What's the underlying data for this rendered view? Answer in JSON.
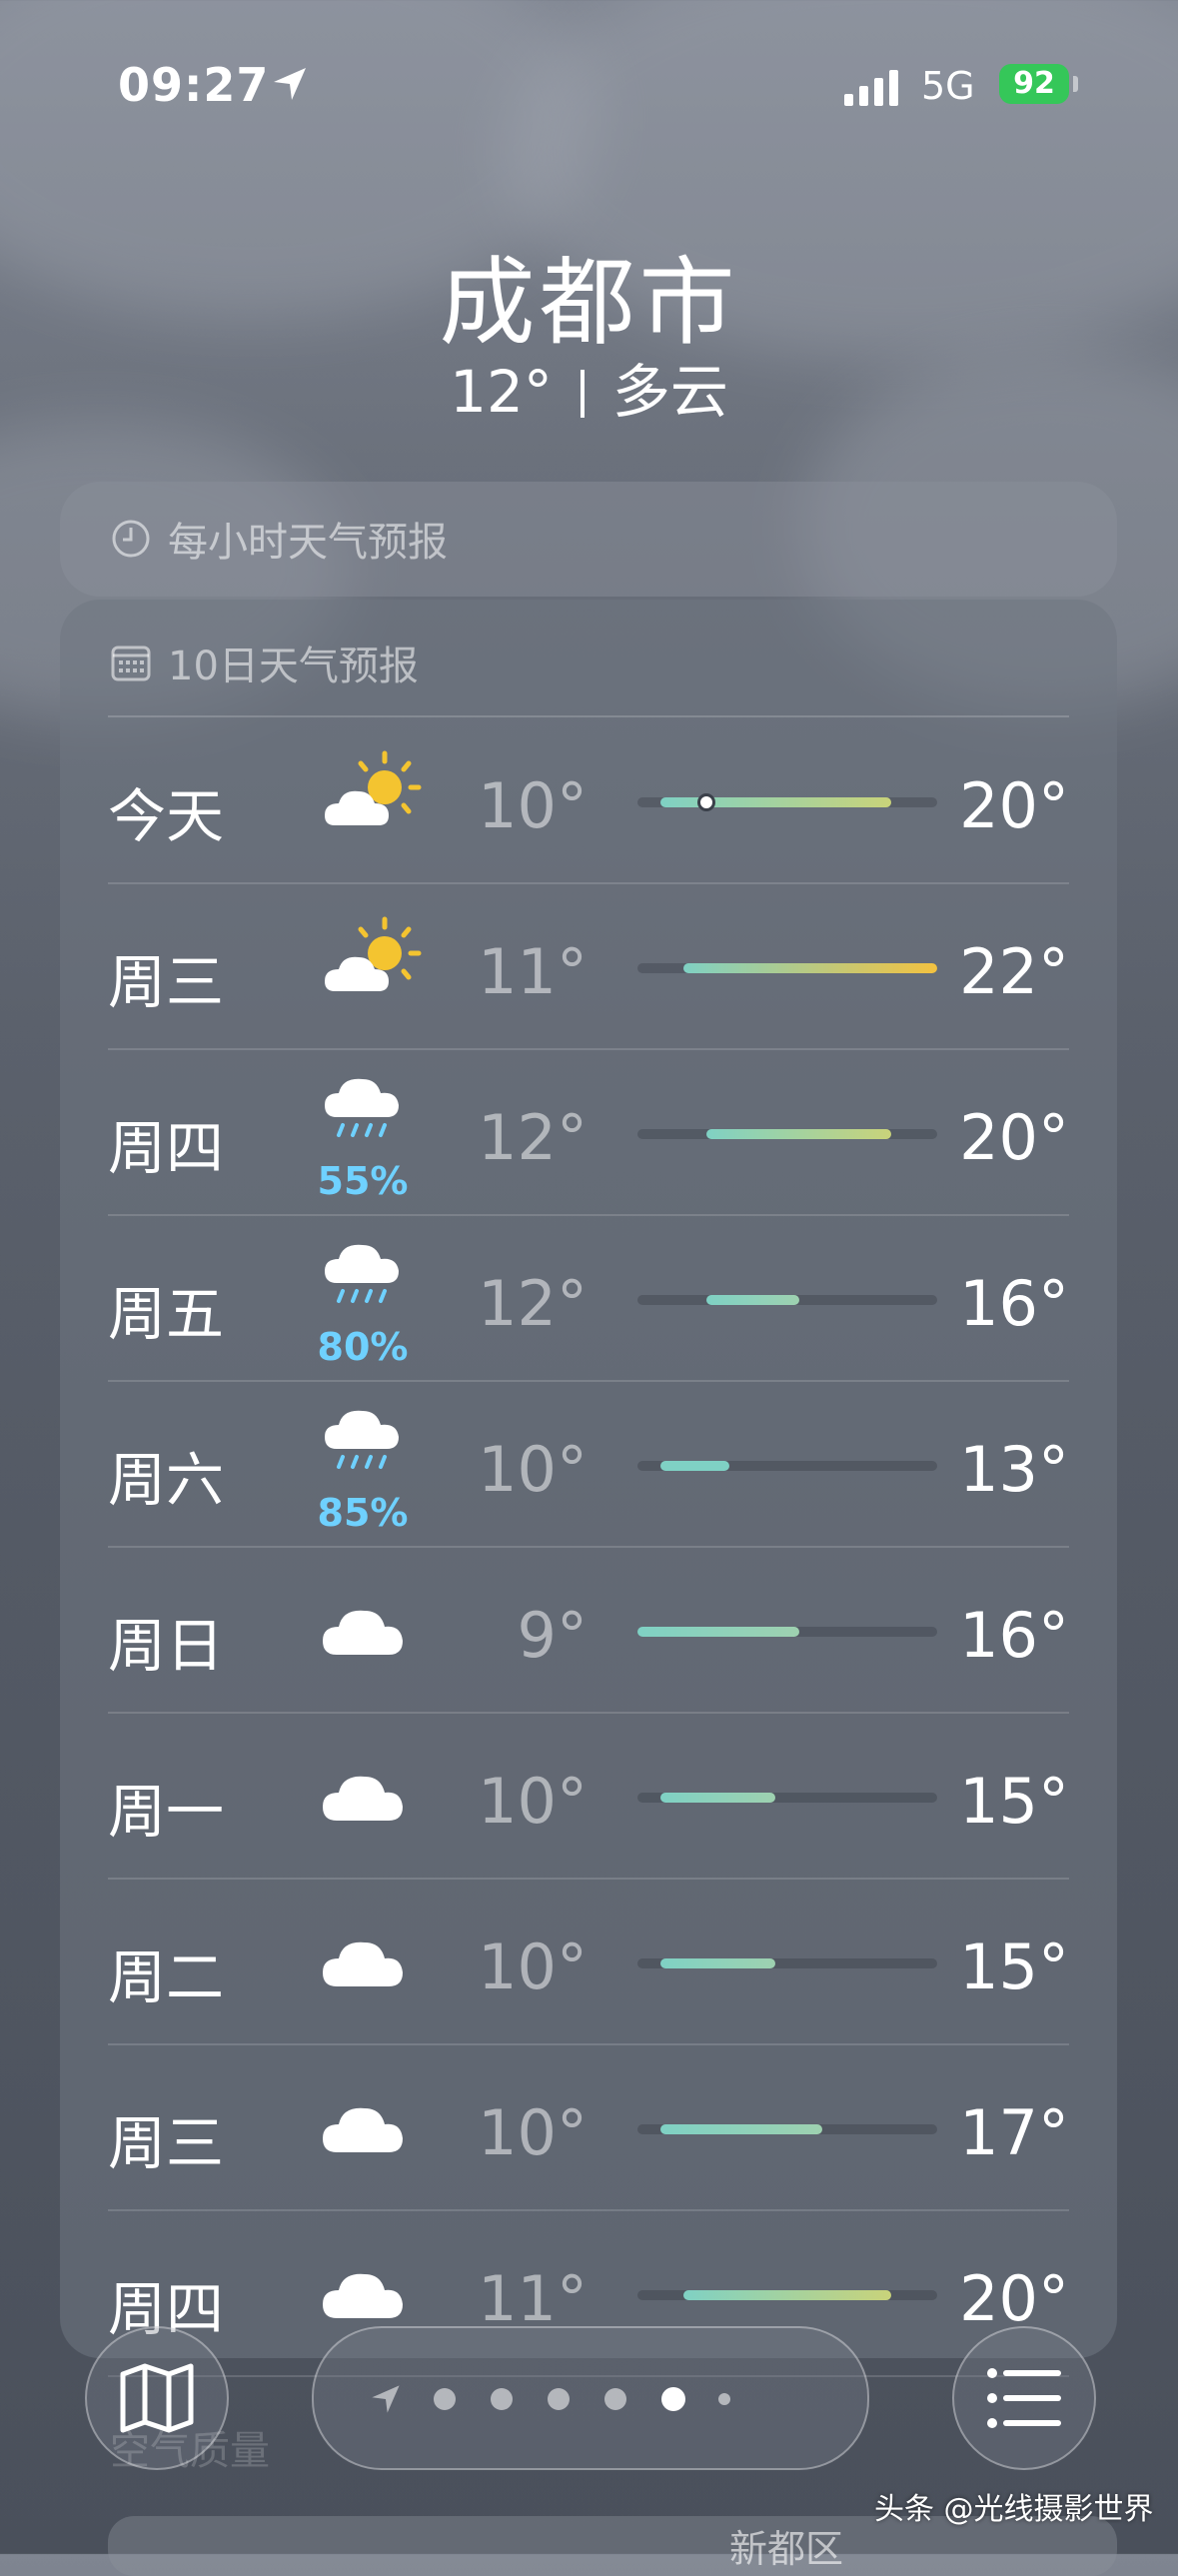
{
  "status_bar": {
    "time": "09:27",
    "network": "5G",
    "battery": "92"
  },
  "location": {
    "city": "成都市",
    "temperature": "12°",
    "condition": "多云"
  },
  "hourly_card": {
    "title": "每小时天气预报",
    "icon": "clock-icon"
  },
  "daily_card": {
    "title": "10日天气预报",
    "icon": "calendar-icon",
    "days": [
      {
        "day": "今天",
        "icon": "partly-sunny-icon",
        "precip": "",
        "low": "10°",
        "high": "20°",
        "range": [
          10,
          20
        ],
        "current": 12
      },
      {
        "day": "周三",
        "icon": "partly-sunny-icon",
        "precip": "",
        "low": "11°",
        "high": "22°",
        "range": [
          11,
          22
        ]
      },
      {
        "day": "周四",
        "icon": "rain-cloud-icon",
        "precip": "55%",
        "low": "12°",
        "high": "20°",
        "range": [
          12,
          20
        ]
      },
      {
        "day": "周五",
        "icon": "rain-cloud-icon",
        "precip": "80%",
        "low": "12°",
        "high": "16°",
        "range": [
          12,
          16
        ]
      },
      {
        "day": "周六",
        "icon": "rain-cloud-icon",
        "precip": "85%",
        "low": "10°",
        "high": "13°",
        "range": [
          10,
          13
        ]
      },
      {
        "day": "周日",
        "icon": "cloud-icon",
        "precip": "",
        "low": "9°",
        "high": "16°",
        "range": [
          9,
          16
        ]
      },
      {
        "day": "周一",
        "icon": "cloud-icon",
        "precip": "",
        "low": "10°",
        "high": "15°",
        "range": [
          10,
          15
        ]
      },
      {
        "day": "周二",
        "icon": "cloud-icon",
        "precip": "",
        "low": "10°",
        "high": "15°",
        "range": [
          10,
          15
        ]
      },
      {
        "day": "周三",
        "icon": "cloud-icon",
        "precip": "",
        "low": "10°",
        "high": "17°",
        "range": [
          10,
          17
        ]
      },
      {
        "day": "周四",
        "icon": "cloud-icon",
        "precip": "",
        "low": "11°",
        "high": "20°",
        "range": [
          11,
          20
        ]
      }
    ],
    "week_min": 9,
    "week_max": 22
  },
  "air_quality": {
    "title": "空气质量",
    "district": "新都区"
  },
  "pager": {
    "count": 7,
    "active": 4
  },
  "watermark": "头条 @光线摄影世界"
}
